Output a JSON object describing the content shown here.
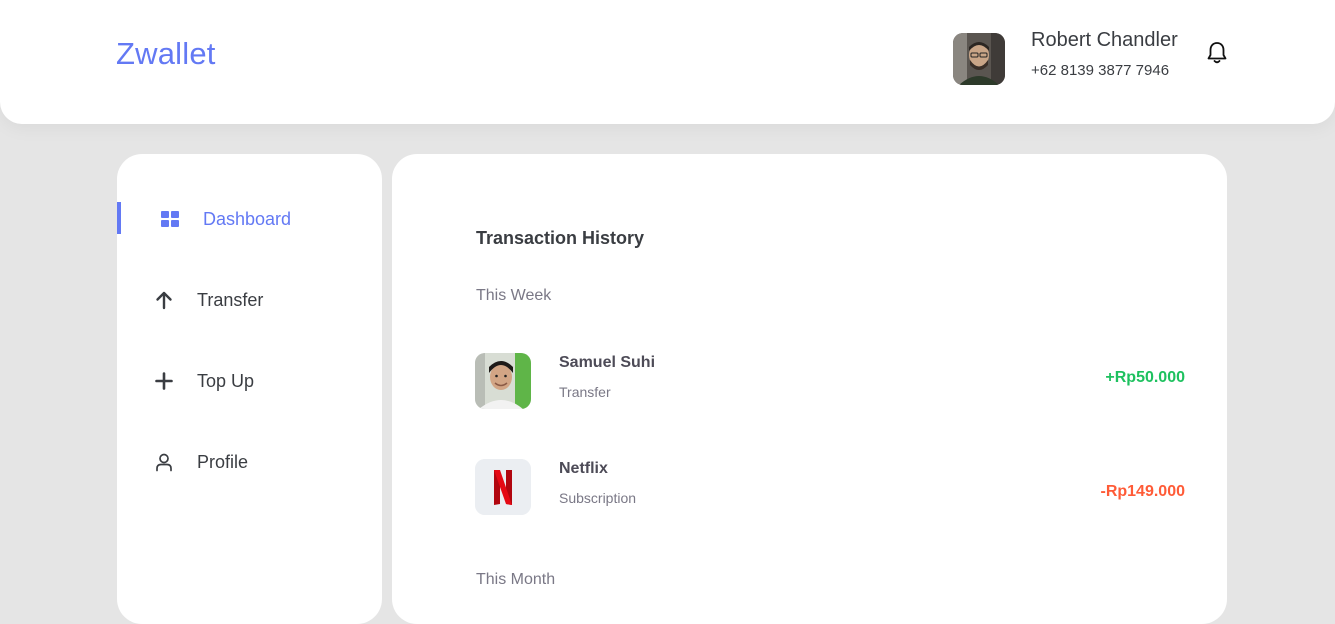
{
  "brand": "Zwallet",
  "user": {
    "name": "Robert Chandler",
    "phone": "+62 8139 3877 7946"
  },
  "sidebar": {
    "items": [
      {
        "label": "Dashboard",
        "icon": "grid-icon",
        "active": true
      },
      {
        "label": "Transfer",
        "icon": "arrow-up-icon"
      },
      {
        "label": "Top Up",
        "icon": "plus-icon"
      },
      {
        "label": "Profile",
        "icon": "user-icon"
      }
    ]
  },
  "main": {
    "title": "Transaction History",
    "groups": [
      {
        "label": "This Week",
        "transactions": [
          {
            "name": "Samuel Suhi",
            "type": "Transfer",
            "amount": "+Rp50.000",
            "color": "#1ec15f"
          },
          {
            "name": "Netflix",
            "type": "Subscription",
            "amount": "-Rp149.000",
            "color": "#ff5b37"
          }
        ]
      },
      {
        "label": "This Month"
      }
    ]
  },
  "colors": {
    "accent": "#6379f4",
    "background": "#e5e5e5",
    "income": "#1ec15f",
    "expense": "#ff5b37"
  }
}
